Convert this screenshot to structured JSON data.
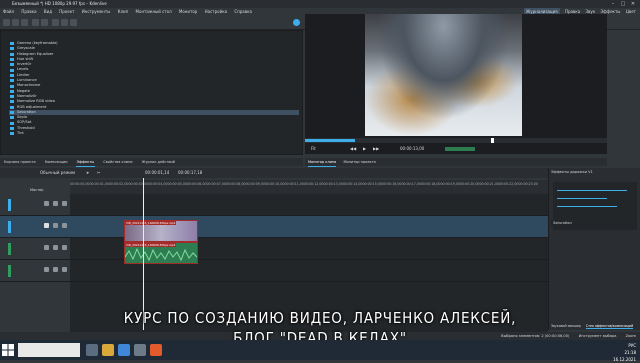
{
  "titlebar": {
    "title": "Безымянный *| HD 1080p 29.97 fps – Kdenlive",
    "minimize": "–",
    "maximize": "□",
    "close": "✕"
  },
  "menu": {
    "items": [
      "Файл",
      "Правка",
      "Вид",
      "Проект",
      "Инструменты",
      "Клип",
      "Монтажный стол",
      "Монитор",
      "Настройка",
      "Справка"
    ]
  },
  "layouts": [
    "Журнализация",
    "Правка",
    "Звук",
    "Эффекты",
    "Цвет"
  ],
  "effects_list": [
    "Gamma (keyframable)",
    "Greyscale",
    "Histogram Equalizer",
    "Hue shift",
    "Invert0r",
    "Levels",
    "Limiter",
    "Luminance",
    "Monochrome",
    "Negate",
    "Normaliz0r",
    "Normalize RGB video",
    "RGB adjustment",
    "Saturation",
    "Sepia",
    "SOP/Sat",
    "Threshold",
    "Tint"
  ],
  "left_tabs": [
    "Корзина проекта",
    "Композиции",
    "Эффекты",
    "Свойства клипа",
    "Журнал действий"
  ],
  "monitor": {
    "timecode": "00:00:13,00",
    "zoom": "Fit"
  },
  "monitor_tabs": [
    "Монитор клипа",
    "Монитор проекта"
  ],
  "timeline": {
    "edit_mode": "Обычный режим",
    "timecode": "00:00:01,14",
    "duration": "00:00:17,18",
    "master_label": "Мастер",
    "ruler": [
      "00:00:00,00",
      "00:00:01,00",
      "00:00:02,00",
      "00:00:03,00",
      "00:00:04,00",
      "00:00:05,00",
      "00:00:06,00",
      "00:00:07,00",
      "00:00:08,00",
      "00:00:09,00",
      "00:00:10,00",
      "00:00:11,00",
      "00:00:12,00",
      "00:00:13,00",
      "00:00:14,00",
      "00:00:15,00",
      "00:00:16,00",
      "00:00:17,00",
      "00:00:18,00",
      "00:00:19,00",
      "00:00:20,00",
      "00:00:21,00",
      "00:00:22,00",
      "00:00:23,00"
    ],
    "video_clip_label": "VID_20211215_140608.306ps.mp4",
    "audio_clip_label": "VID_20211215_140608.306ps.mp4"
  },
  "right_panel": {
    "title": "Эффекты дорожки V1",
    "effect_name": "Saturation",
    "tabs": [
      "Звуковой микшер",
      "Стек эффектов/композиций"
    ]
  },
  "subtitle": {
    "line1": "КУРС ПО СОЗДАНИЮ ВИДЕО, ЛАРЧЕНКО АЛЕКСЕЙ,",
    "line2": "БЛОГ \"DEAD В КЕДАХ\""
  },
  "statusbar": {
    "selected": "Выбрано элементов: 2 (00:00:06,00)",
    "tool": "Инструмент выбора",
    "zoom": "Zoom"
  },
  "taskbar": {
    "search_placeholder": "",
    "lang": "РУС",
    "time": "21:18",
    "date": "16.12.2021"
  },
  "colors": {
    "accent": "#3daee9",
    "clip_border": "#a52b2b",
    "audio_clip": "#2e7d50"
  }
}
